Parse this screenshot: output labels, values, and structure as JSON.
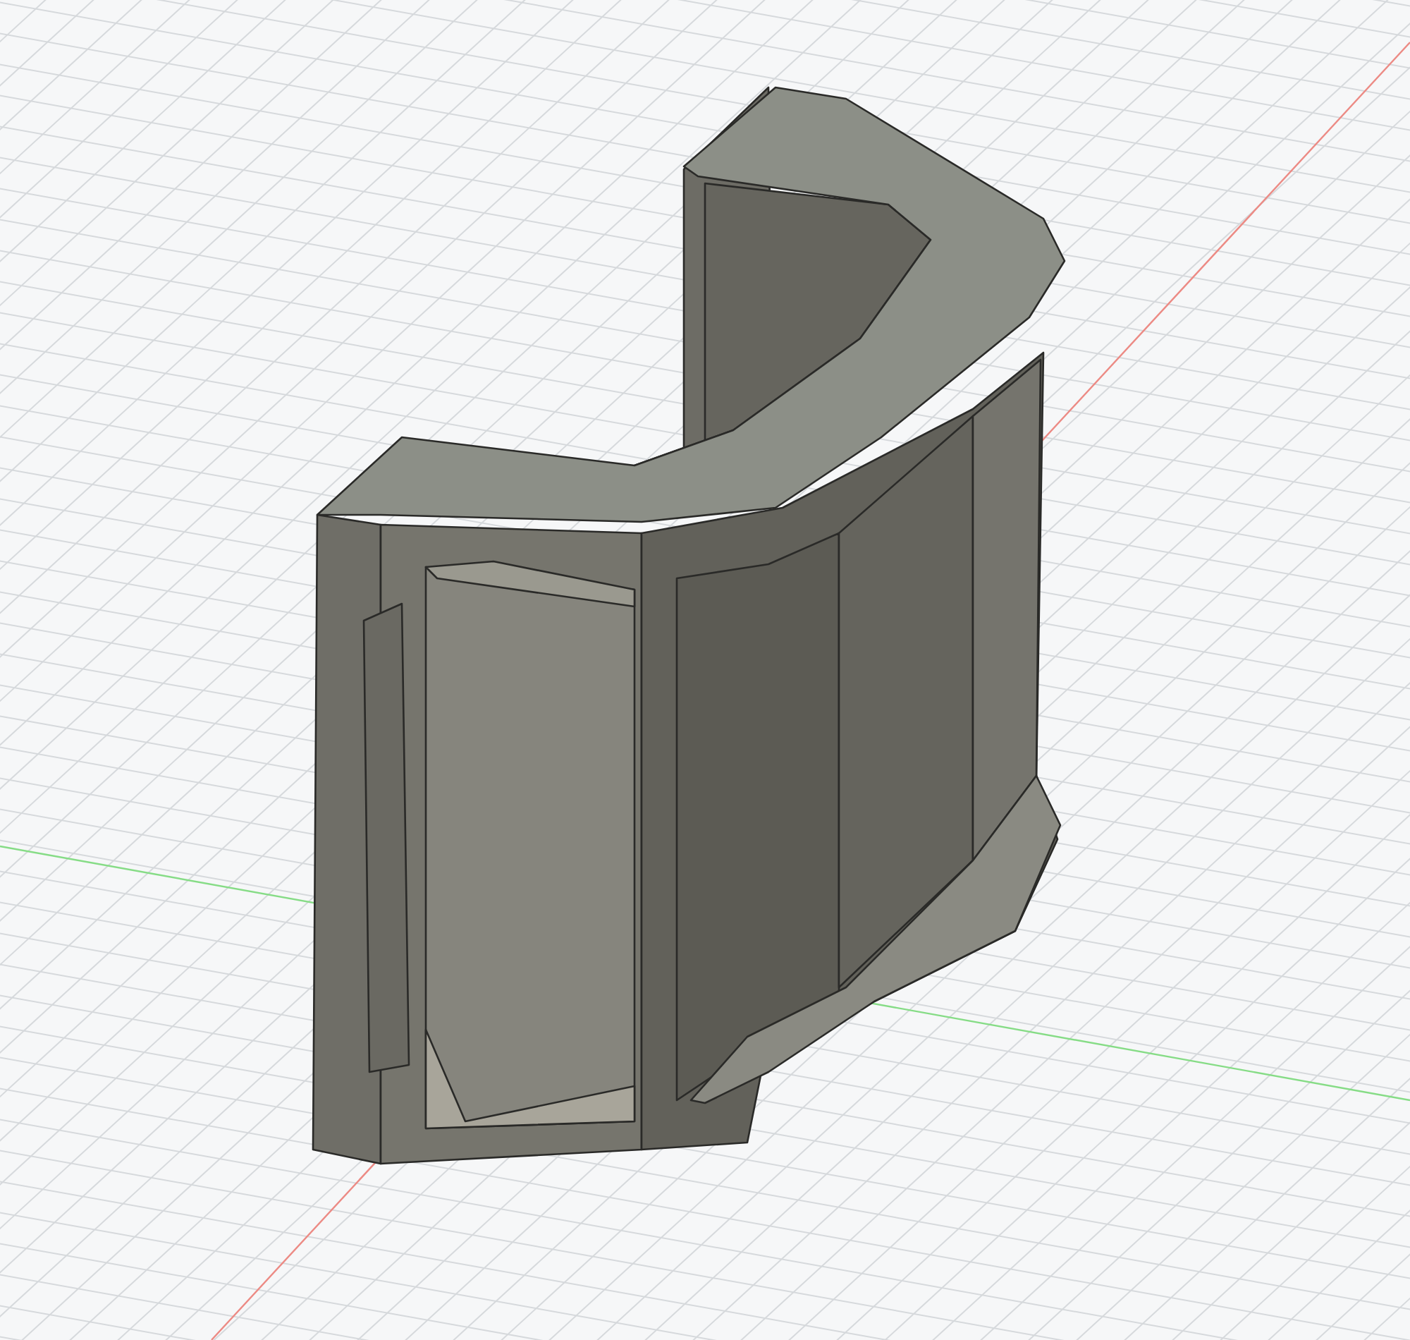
{
  "viewport": {
    "show_grid": true,
    "axes": [
      {
        "kind": "x",
        "color": "#ec8a84"
      },
      {
        "kind": "y",
        "color": "#86dc86"
      }
    ]
  }
}
